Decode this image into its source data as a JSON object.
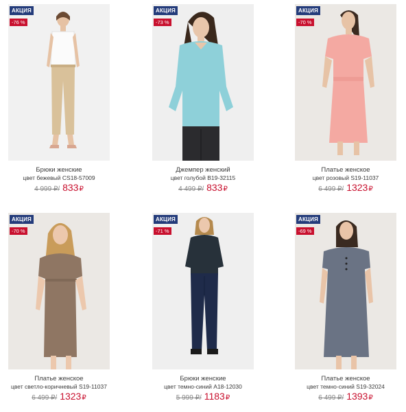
{
  "products": [
    {
      "sale_label": "АКЦИЯ",
      "discount": "-76 %",
      "name": "Брюки женские",
      "color": "цвет бежевый CS18-57009",
      "old_price": "4 999 ₽/",
      "new_price": "833",
      "currency": "₽",
      "photo": "model-beige-trousers"
    },
    {
      "sale_label": "АКЦИЯ",
      "discount": "-73 %",
      "name": "Джемпер женский",
      "color": "цвет голубой B19-32115",
      "old_price": "4 499 ₽/",
      "new_price": "833",
      "currency": "₽",
      "photo": "model-blue-jumper"
    },
    {
      "sale_label": "АКЦИЯ",
      "discount": "-70 %",
      "name": "Платье женское",
      "color": "цвет розовый S19-11037",
      "old_price": "6 499 ₽/",
      "new_price": "1323",
      "currency": "₽",
      "photo": "model-pink-dress"
    },
    {
      "sale_label": "АКЦИЯ",
      "discount": "-70 %",
      "name": "Платье женское",
      "color": "цвет светло-коричневый S19-11037",
      "old_price": "6 499 ₽/",
      "new_price": "1323",
      "currency": "₽",
      "photo": "model-brown-dress"
    },
    {
      "sale_label": "АКЦИЯ",
      "discount": "-71 %",
      "name": "Брюки женские",
      "color": "цвет темно-синий A18-12030",
      "old_price": "5 999 ₽/",
      "new_price": "1183",
      "currency": "₽",
      "photo": "model-navy-trousers"
    },
    {
      "sale_label": "АКЦИЯ",
      "discount": "-69 %",
      "name": "Платье женское",
      "color": "цвет темно-синий S19-32024",
      "old_price": "6 499 ₽/",
      "new_price": "1393",
      "currency": "₽",
      "photo": "model-navy-dress"
    }
  ],
  "colors": {
    "sale_badge": "#233b7a",
    "discount_badge": "#c8102e",
    "new_price": "#c8102e",
    "old_price": "#8a8a8a"
  }
}
